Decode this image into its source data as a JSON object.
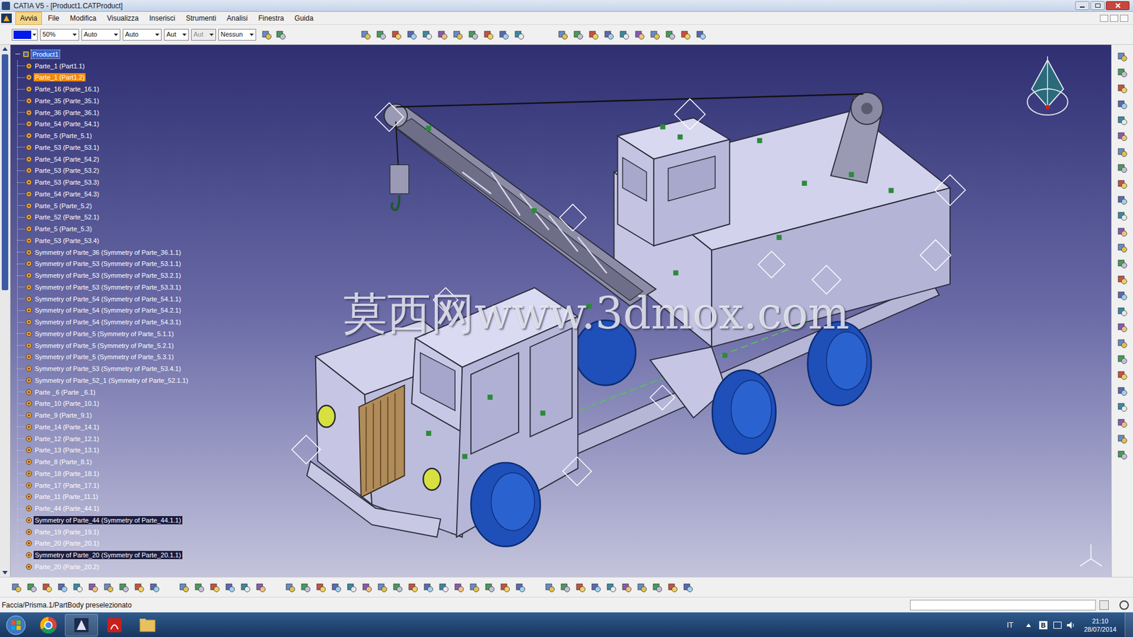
{
  "window": {
    "title": "CATIA V5 - [Product1.CATProduct]"
  },
  "menu": [
    {
      "label": "Avvia",
      "selected": true
    },
    {
      "label": "File",
      "selected": false
    },
    {
      "label": "Modifica",
      "selected": false
    },
    {
      "label": "Visualizza",
      "selected": false
    },
    {
      "label": "Inserisci",
      "selected": false
    },
    {
      "label": "Strumenti",
      "selected": false
    },
    {
      "label": "Analisi",
      "selected": false
    },
    {
      "label": "Finestra",
      "selected": false
    },
    {
      "label": "Guida",
      "selected": false
    }
  ],
  "toolbar": {
    "color_swatch": "#0018e8",
    "dropdowns": [
      {
        "value": "50%",
        "disabled": false
      },
      {
        "value": "Auto",
        "disabled": false
      },
      {
        "value": "Auto",
        "disabled": false
      },
      {
        "value": "Aut",
        "disabled": false
      },
      {
        "value": "Aut",
        "disabled": true
      },
      {
        "value": "Nessun",
        "disabled": false
      }
    ]
  },
  "tree": {
    "root": {
      "label": "Product1",
      "selected": true
    },
    "items": [
      {
        "label": "Parte_1 (Part1.1)",
        "preselected": false,
        "emphasized": false
      },
      {
        "label": "Parte_1 (Part1.2)",
        "preselected": true,
        "emphasized": false
      },
      {
        "label": "Parte_16 (Parte_16.1)",
        "preselected": false,
        "emphasized": false
      },
      {
        "label": "Parte_35 (Parte_35.1)",
        "preselected": false,
        "emphasized": false
      },
      {
        "label": "Parte_36 (Parte_36.1)",
        "preselected": false,
        "emphasized": false
      },
      {
        "label": "Parte_54 (Parte_54.1)",
        "preselected": false,
        "emphasized": false
      },
      {
        "label": "Parte_5 (Parte_5.1)",
        "preselected": false,
        "emphasized": false
      },
      {
        "label": "Parte_53 (Parte_53.1)",
        "preselected": false,
        "emphasized": false
      },
      {
        "label": "Parte_54 (Parte_54.2)",
        "preselected": false,
        "emphasized": false
      },
      {
        "label": "Parte_53 (Parte_53.2)",
        "preselected": false,
        "emphasized": false
      },
      {
        "label": "Parte_53 (Parte_53.3)",
        "preselected": false,
        "emphasized": false
      },
      {
        "label": "Parte_54 (Parte_54.3)",
        "preselected": false,
        "emphasized": false
      },
      {
        "label": "Parte_5 (Parte_5.2)",
        "preselected": false,
        "emphasized": false
      },
      {
        "label": "Parte_52 (Parte_52.1)",
        "preselected": false,
        "emphasized": false
      },
      {
        "label": "Parte_5 (Parte_5.3)",
        "preselected": false,
        "emphasized": false
      },
      {
        "label": "Parte_53 (Parte_53.4)",
        "preselected": false,
        "emphasized": false
      },
      {
        "label": "Symmetry of Parte_36 (Symmetry of Parte_36.1.1)",
        "preselected": false,
        "emphasized": false
      },
      {
        "label": "Symmetry of Parte_53 (Symmetry of Parte_53.1.1)",
        "preselected": false,
        "emphasized": false
      },
      {
        "label": "Symmetry of Parte_53 (Symmetry of Parte_53.2.1)",
        "preselected": false,
        "emphasized": false
      },
      {
        "label": "Symmetry of Parte_53 (Symmetry of Parte_53.3.1)",
        "preselected": false,
        "emphasized": false
      },
      {
        "label": "Symmetry of Parte_54 (Symmetry of Parte_54.1.1)",
        "preselected": false,
        "emphasized": false
      },
      {
        "label": "Symmetry of Parte_54 (Symmetry of Parte_54.2.1)",
        "preselected": false,
        "emphasized": false
      },
      {
        "label": "Symmetry of Parte_54 (Symmetry of Parte_54.3.1)",
        "preselected": false,
        "emphasized": false
      },
      {
        "label": "Symmetry of Parte_5 (Symmetry of Parte_5.1.1)",
        "preselected": false,
        "emphasized": false
      },
      {
        "label": "Symmetry of Parte_5 (Symmetry of Parte_5.2.1)",
        "preselected": false,
        "emphasized": false
      },
      {
        "label": "Symmetry of Parte_5 (Symmetry of Parte_5.3.1)",
        "preselected": false,
        "emphasized": false
      },
      {
        "label": "Symmetry of Parte_53 (Symmetry of Parte_53.4.1)",
        "preselected": false,
        "emphasized": false
      },
      {
        "label": "Symmetry of Parte_52_1 (Symmetry of Parte_52.1.1)",
        "preselected": false,
        "emphasized": false
      },
      {
        "label": "Parte _6 (Parte _6.1)",
        "preselected": false,
        "emphasized": false
      },
      {
        "label": "Parte_10 (Parte_10.1)",
        "preselected": false,
        "emphasized": false
      },
      {
        "label": "Parte_9 (Parte_9.1)",
        "preselected": false,
        "emphasized": false
      },
      {
        "label": "Parte_14 (Parte_14.1)",
        "preselected": false,
        "emphasized": false
      },
      {
        "label": "Parte_12 (Parte_12.1)",
        "preselected": false,
        "emphasized": false
      },
      {
        "label": "Parte_13 (Parte_13.1)",
        "preselected": false,
        "emphasized": false
      },
      {
        "label": "Parte_8 (Parte_8.1)",
        "preselected": false,
        "emphasized": false
      },
      {
        "label": "Parte_18 (Parte_18.1)",
        "preselected": false,
        "emphasized": false
      },
      {
        "label": "Parte_17 (Parte_17.1)",
        "preselected": false,
        "emphasized": false
      },
      {
        "label": "Parte_11 (Parte_11.1)",
        "preselected": false,
        "emphasized": false
      },
      {
        "label": "Parte_44 (Parte_44.1)",
        "preselected": false,
        "emphasized": false
      },
      {
        "label": "Symmetry of Parte_44 (Symmetry of Parte_44.1.1)",
        "preselected": false,
        "emphasized": true
      },
      {
        "label": "Parte_19 (Parte_19.1)",
        "preselected": false,
        "emphasized": false
      },
      {
        "label": "Parte_20 (Parte_20.1)",
        "preselected": false,
        "emphasized": false
      },
      {
        "label": "Symmetry of Parte_20 (Symmetry of Parte_20.1.1)",
        "preselected": false,
        "emphasized": true
      },
      {
        "label": "Parte_20 (Parte_20.2)",
        "preselected": false,
        "emphasized": false
      }
    ]
  },
  "viewport": {
    "watermark": "莫西网www.3dmox.com"
  },
  "status_bar": {
    "text": "Faccia/Prisma.1/PartBody preselezionato"
  },
  "taskbar": {
    "language": "IT",
    "tray_badge": "B",
    "time": "21:10",
    "date": "28/07/2014"
  }
}
